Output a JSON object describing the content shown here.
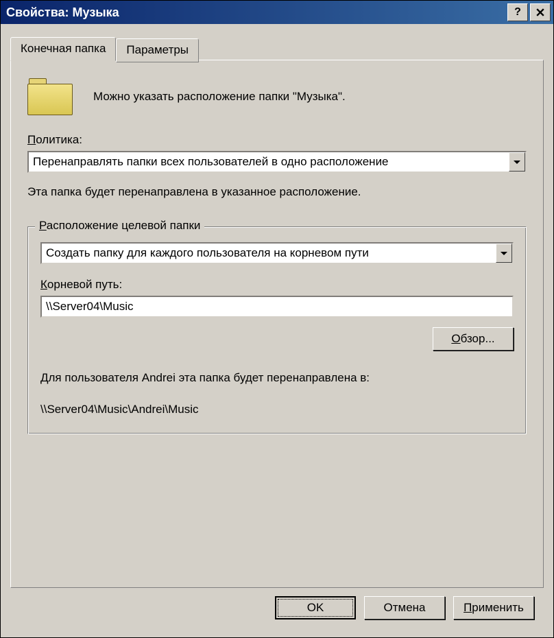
{
  "title": "Свойства: Музыка",
  "tabs": {
    "target": "Конечная папка",
    "settings": "Параметры"
  },
  "intro": "Можно указать расположение папки \"Музыка\".",
  "policy": {
    "label_pre": "П",
    "label_rest": "олитика:",
    "value": "Перенаправлять папки всех пользователей в одно расположение",
    "hint": "Эта папка будет перенаправлена в указанное расположение."
  },
  "group": {
    "legend_pre": "Р",
    "legend_rest": "асположение целевой папки",
    "mode": "Создать папку для каждого пользователя на корневом пути",
    "root_label_pre": "К",
    "root_label_rest": "орневой путь:",
    "root_value": "\\\\Server04\\Music",
    "browse_pre": "О",
    "browse_rest": "бзор...",
    "redirect_line1": "Для пользователя Andrei эта папка будет перенаправлена в:",
    "redirect_line2": "\\\\Server04\\Music\\Andrei\\Music"
  },
  "buttons": {
    "ok": "OK",
    "cancel": "Отмена",
    "apply_pre": "П",
    "apply_rest": "рименить"
  }
}
